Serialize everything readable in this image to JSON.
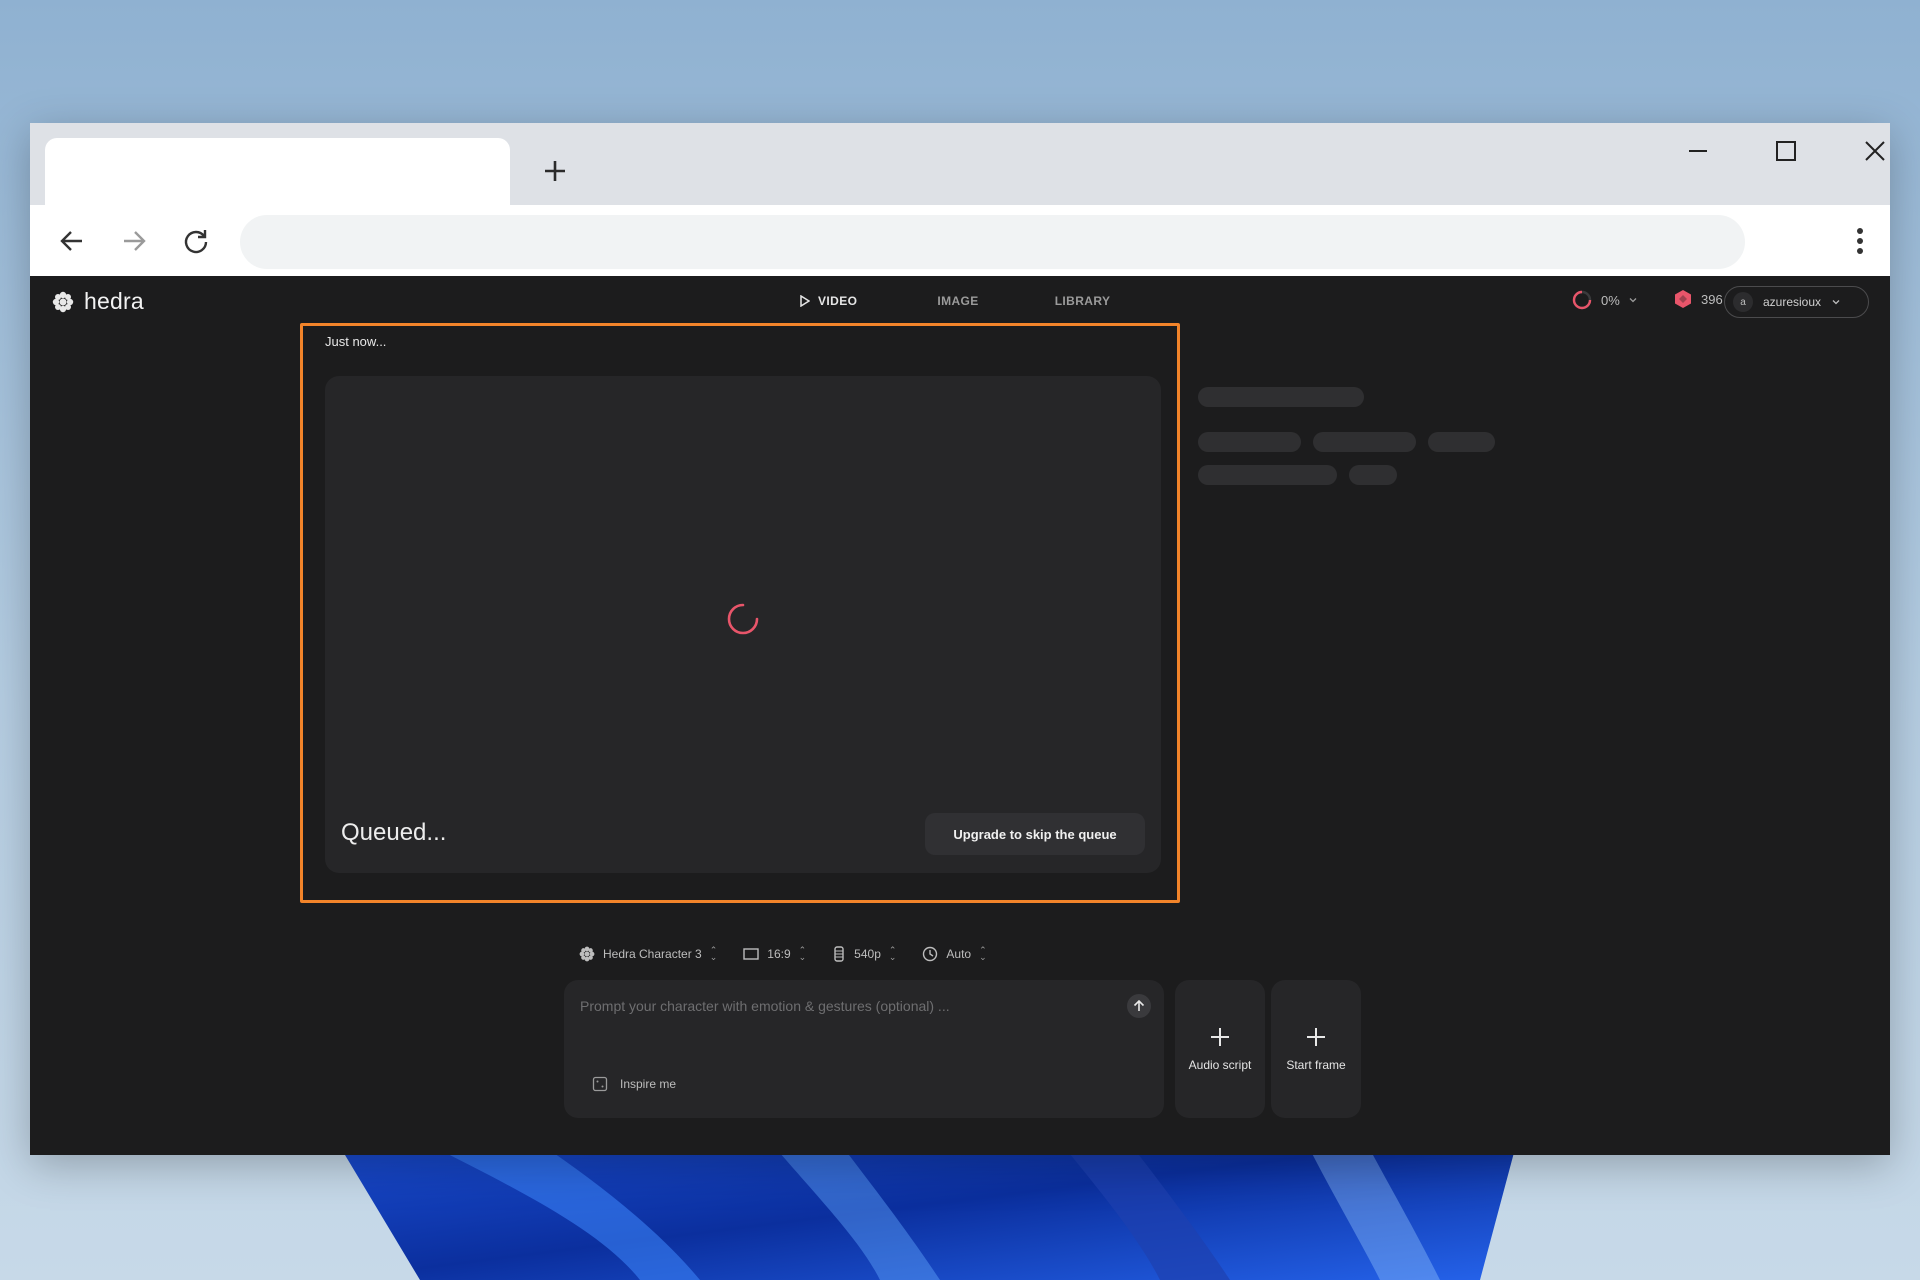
{
  "browser": {
    "new_tab_icon": "plus-icon",
    "controls": [
      "minimize-icon",
      "maximize-icon",
      "close-icon"
    ],
    "nav": [
      "back-arrow-icon",
      "forward-arrow-icon",
      "reload-icon"
    ],
    "menu_icon": "kebab-menu-icon"
  },
  "app": {
    "brand": "hedra",
    "nav": {
      "video": "VIDEO",
      "image": "IMAGE",
      "library": "LIBRARY"
    },
    "progress": "0%",
    "credits": "396",
    "user": {
      "initial": "a",
      "name": "azuresioux"
    }
  },
  "job": {
    "timestamp": "Just now...",
    "status": "Queued...",
    "upgrade_label": "Upgrade to skip the queue"
  },
  "settings": {
    "model": "Hedra Character 3",
    "aspect": "16:9",
    "resolution": "540p",
    "duration": "Auto"
  },
  "prompt": {
    "placeholder": "Prompt your character with emotion & gestures (optional) ...",
    "value": "",
    "inspire": "Inspire me"
  },
  "cards": {
    "audio": "Audio script",
    "start": "Start frame"
  },
  "colors": {
    "accent": "#e8556a",
    "highlight": "#f2842a",
    "background": "#1c1c1d",
    "panel": "#262628"
  }
}
